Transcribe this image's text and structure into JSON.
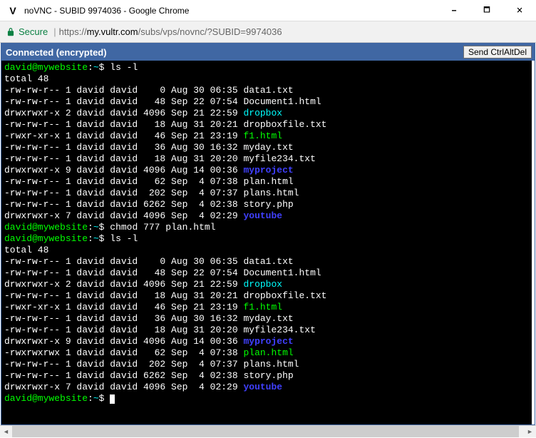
{
  "window": {
    "icon_letter": "V",
    "title": "noVNC - SUBID 9974036 - Google Chrome",
    "controls": {
      "min": "🗕",
      "max": "🗖",
      "close": "🗙"
    }
  },
  "address": {
    "secure": "Secure",
    "scheme": "https",
    "domain": "my.vultr.com",
    "path": "/subs/vps/novnc/?SUBID=9974036"
  },
  "vnc": {
    "status": "Connected (encrypted)",
    "button": "Send CtrlAltDel"
  },
  "terminal": {
    "prompt_user": "david@mywebsite",
    "prompt_path": "~",
    "cmd1": "ls -l",
    "total1": "total 48",
    "listing1": [
      {
        "perm": "-rw-rw-r--",
        "lnk": "1",
        "own": "david",
        "grp": "david",
        "size": "   0",
        "date": "Aug 30 06:35",
        "name": "data1.txt",
        "cls": "w"
      },
      {
        "perm": "-rw-rw-r--",
        "lnk": "1",
        "own": "david",
        "grp": "david",
        "size": "  48",
        "date": "Sep 22 07:54",
        "name": "Document1.html",
        "cls": "w"
      },
      {
        "perm": "drwxrwxr-x",
        "lnk": "2",
        "own": "david",
        "grp": "david",
        "size": "4096",
        "date": "Sep 21 22:59",
        "name": "dropbox",
        "cls": "c"
      },
      {
        "perm": "-rw-rw-r--",
        "lnk": "1",
        "own": "david",
        "grp": "david",
        "size": "  18",
        "date": "Aug 31 20:21",
        "name": "dropboxfile.txt",
        "cls": "w"
      },
      {
        "perm": "-rwxr-xr-x",
        "lnk": "1",
        "own": "david",
        "grp": "david",
        "size": "  46",
        "date": "Sep 21 23:19",
        "name": "f1.html",
        "cls": "g"
      },
      {
        "perm": "-rw-rw-r--",
        "lnk": "1",
        "own": "david",
        "grp": "david",
        "size": "  36",
        "date": "Aug 30 16:32",
        "name": "myday.txt",
        "cls": "w"
      },
      {
        "perm": "-rw-rw-r--",
        "lnk": "1",
        "own": "david",
        "grp": "david",
        "size": "  18",
        "date": "Aug 31 20:20",
        "name": "myfile234.txt",
        "cls": "w"
      },
      {
        "perm": "drwxrwxr-x",
        "lnk": "9",
        "own": "david",
        "grp": "david",
        "size": "4096",
        "date": "Aug 14 00:36",
        "name": "myproject",
        "cls": "b"
      },
      {
        "perm": "-rw-rw-r--",
        "lnk": "1",
        "own": "david",
        "grp": "david",
        "size": "  62",
        "date": "Sep  4 07:38",
        "name": "plan.html",
        "cls": "w"
      },
      {
        "perm": "-rw-rw-r--",
        "lnk": "1",
        "own": "david",
        "grp": "david",
        "size": " 202",
        "date": "Sep  4 07:37",
        "name": "plans.html",
        "cls": "w"
      },
      {
        "perm": "-rw-rw-r--",
        "lnk": "1",
        "own": "david",
        "grp": "david",
        "size": "6262",
        "date": "Sep  4 02:38",
        "name": "story.php",
        "cls": "w"
      },
      {
        "perm": "drwxrwxr-x",
        "lnk": "7",
        "own": "david",
        "grp": "david",
        "size": "4096",
        "date": "Sep  4 02:29",
        "name": "youtube",
        "cls": "b"
      }
    ],
    "cmd2": "chmod 777 plan.html",
    "cmd3": "ls -l",
    "total2": "total 48",
    "listing2": [
      {
        "perm": "-rw-rw-r--",
        "lnk": "1",
        "own": "david",
        "grp": "david",
        "size": "   0",
        "date": "Aug 30 06:35",
        "name": "data1.txt",
        "cls": "w"
      },
      {
        "perm": "-rw-rw-r--",
        "lnk": "1",
        "own": "david",
        "grp": "david",
        "size": "  48",
        "date": "Sep 22 07:54",
        "name": "Document1.html",
        "cls": "w"
      },
      {
        "perm": "drwxrwxr-x",
        "lnk": "2",
        "own": "david",
        "grp": "david",
        "size": "4096",
        "date": "Sep 21 22:59",
        "name": "dropbox",
        "cls": "c"
      },
      {
        "perm": "-rw-rw-r--",
        "lnk": "1",
        "own": "david",
        "grp": "david",
        "size": "  18",
        "date": "Aug 31 20:21",
        "name": "dropboxfile.txt",
        "cls": "w"
      },
      {
        "perm": "-rwxr-xr-x",
        "lnk": "1",
        "own": "david",
        "grp": "david",
        "size": "  46",
        "date": "Sep 21 23:19",
        "name": "f1.html",
        "cls": "g"
      },
      {
        "perm": "-rw-rw-r--",
        "lnk": "1",
        "own": "david",
        "grp": "david",
        "size": "  36",
        "date": "Aug 30 16:32",
        "name": "myday.txt",
        "cls": "w"
      },
      {
        "perm": "-rw-rw-r--",
        "lnk": "1",
        "own": "david",
        "grp": "david",
        "size": "  18",
        "date": "Aug 31 20:20",
        "name": "myfile234.txt",
        "cls": "w"
      },
      {
        "perm": "drwxrwxr-x",
        "lnk": "9",
        "own": "david",
        "grp": "david",
        "size": "4096",
        "date": "Aug 14 00:36",
        "name": "myproject",
        "cls": "b"
      },
      {
        "perm": "-rwxrwxrwx",
        "lnk": "1",
        "own": "david",
        "grp": "david",
        "size": "  62",
        "date": "Sep  4 07:38",
        "name": "plan.html",
        "cls": "g"
      },
      {
        "perm": "-rw-rw-r--",
        "lnk": "1",
        "own": "david",
        "grp": "david",
        "size": " 202",
        "date": "Sep  4 07:37",
        "name": "plans.html",
        "cls": "w"
      },
      {
        "perm": "-rw-rw-r--",
        "lnk": "1",
        "own": "david",
        "grp": "david",
        "size": "6262",
        "date": "Sep  4 02:38",
        "name": "story.php",
        "cls": "w"
      },
      {
        "perm": "drwxrwxr-x",
        "lnk": "7",
        "own": "david",
        "grp": "david",
        "size": "4096",
        "date": "Sep  4 02:29",
        "name": "youtube",
        "cls": "b"
      }
    ]
  }
}
